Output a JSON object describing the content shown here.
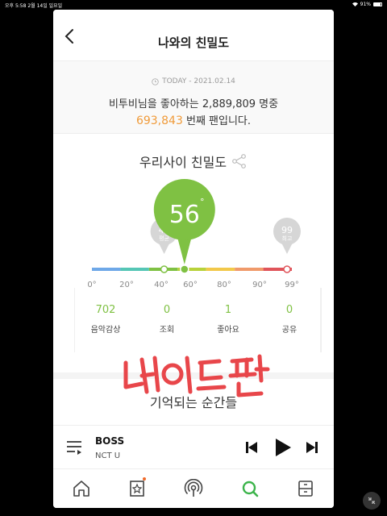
{
  "status_bar": {
    "left": "오후 5:58   2월 14일 일요일",
    "battery": "91%"
  },
  "header": {
    "title": "나와의 친밀도"
  },
  "today": {
    "label": "TODAY - 2021.02.14",
    "fans_line": "비투비님을 좋아하는 2,889,809 명중",
    "rank_number": "693,843",
    "rank_suffix": " 번째 팬입니다."
  },
  "intimacy": {
    "title": "우리사이 친밀도",
    "value": 56,
    "value_label": "56",
    "degree_symbol": "°",
    "average": {
      "value": "42",
      "label": "평균",
      "level": 42
    },
    "max": {
      "value": "99",
      "label": "최고",
      "level": 99
    },
    "scale_labels": [
      "0°",
      "20°",
      "40°",
      "60°",
      "80°",
      "90°",
      "99°"
    ],
    "segment_colors": [
      "#6ea8e8",
      "#55c6b5",
      "#7fc143",
      "#b8d23a",
      "#f2c84a",
      "#f09a6a",
      "#e0545a"
    ],
    "accent": "#7fc143",
    "grey": "#d6d6d6"
  },
  "stats": [
    {
      "value": "702",
      "label": "음악감상"
    },
    {
      "value": "0",
      "label": "조회"
    },
    {
      "value": "1",
      "label": "좋아요"
    },
    {
      "value": "0",
      "label": "공유"
    }
  ],
  "memories": {
    "title": "기억되는 순간들"
  },
  "overlay_stamp": "네이트판",
  "player": {
    "song_title": "BOSS",
    "artist": "NCT U"
  },
  "tabs": [
    {
      "name": "home-icon"
    },
    {
      "name": "star-card-icon"
    },
    {
      "name": "broadcast-icon"
    },
    {
      "name": "search-icon",
      "active": true
    },
    {
      "name": "storage-icon"
    }
  ]
}
